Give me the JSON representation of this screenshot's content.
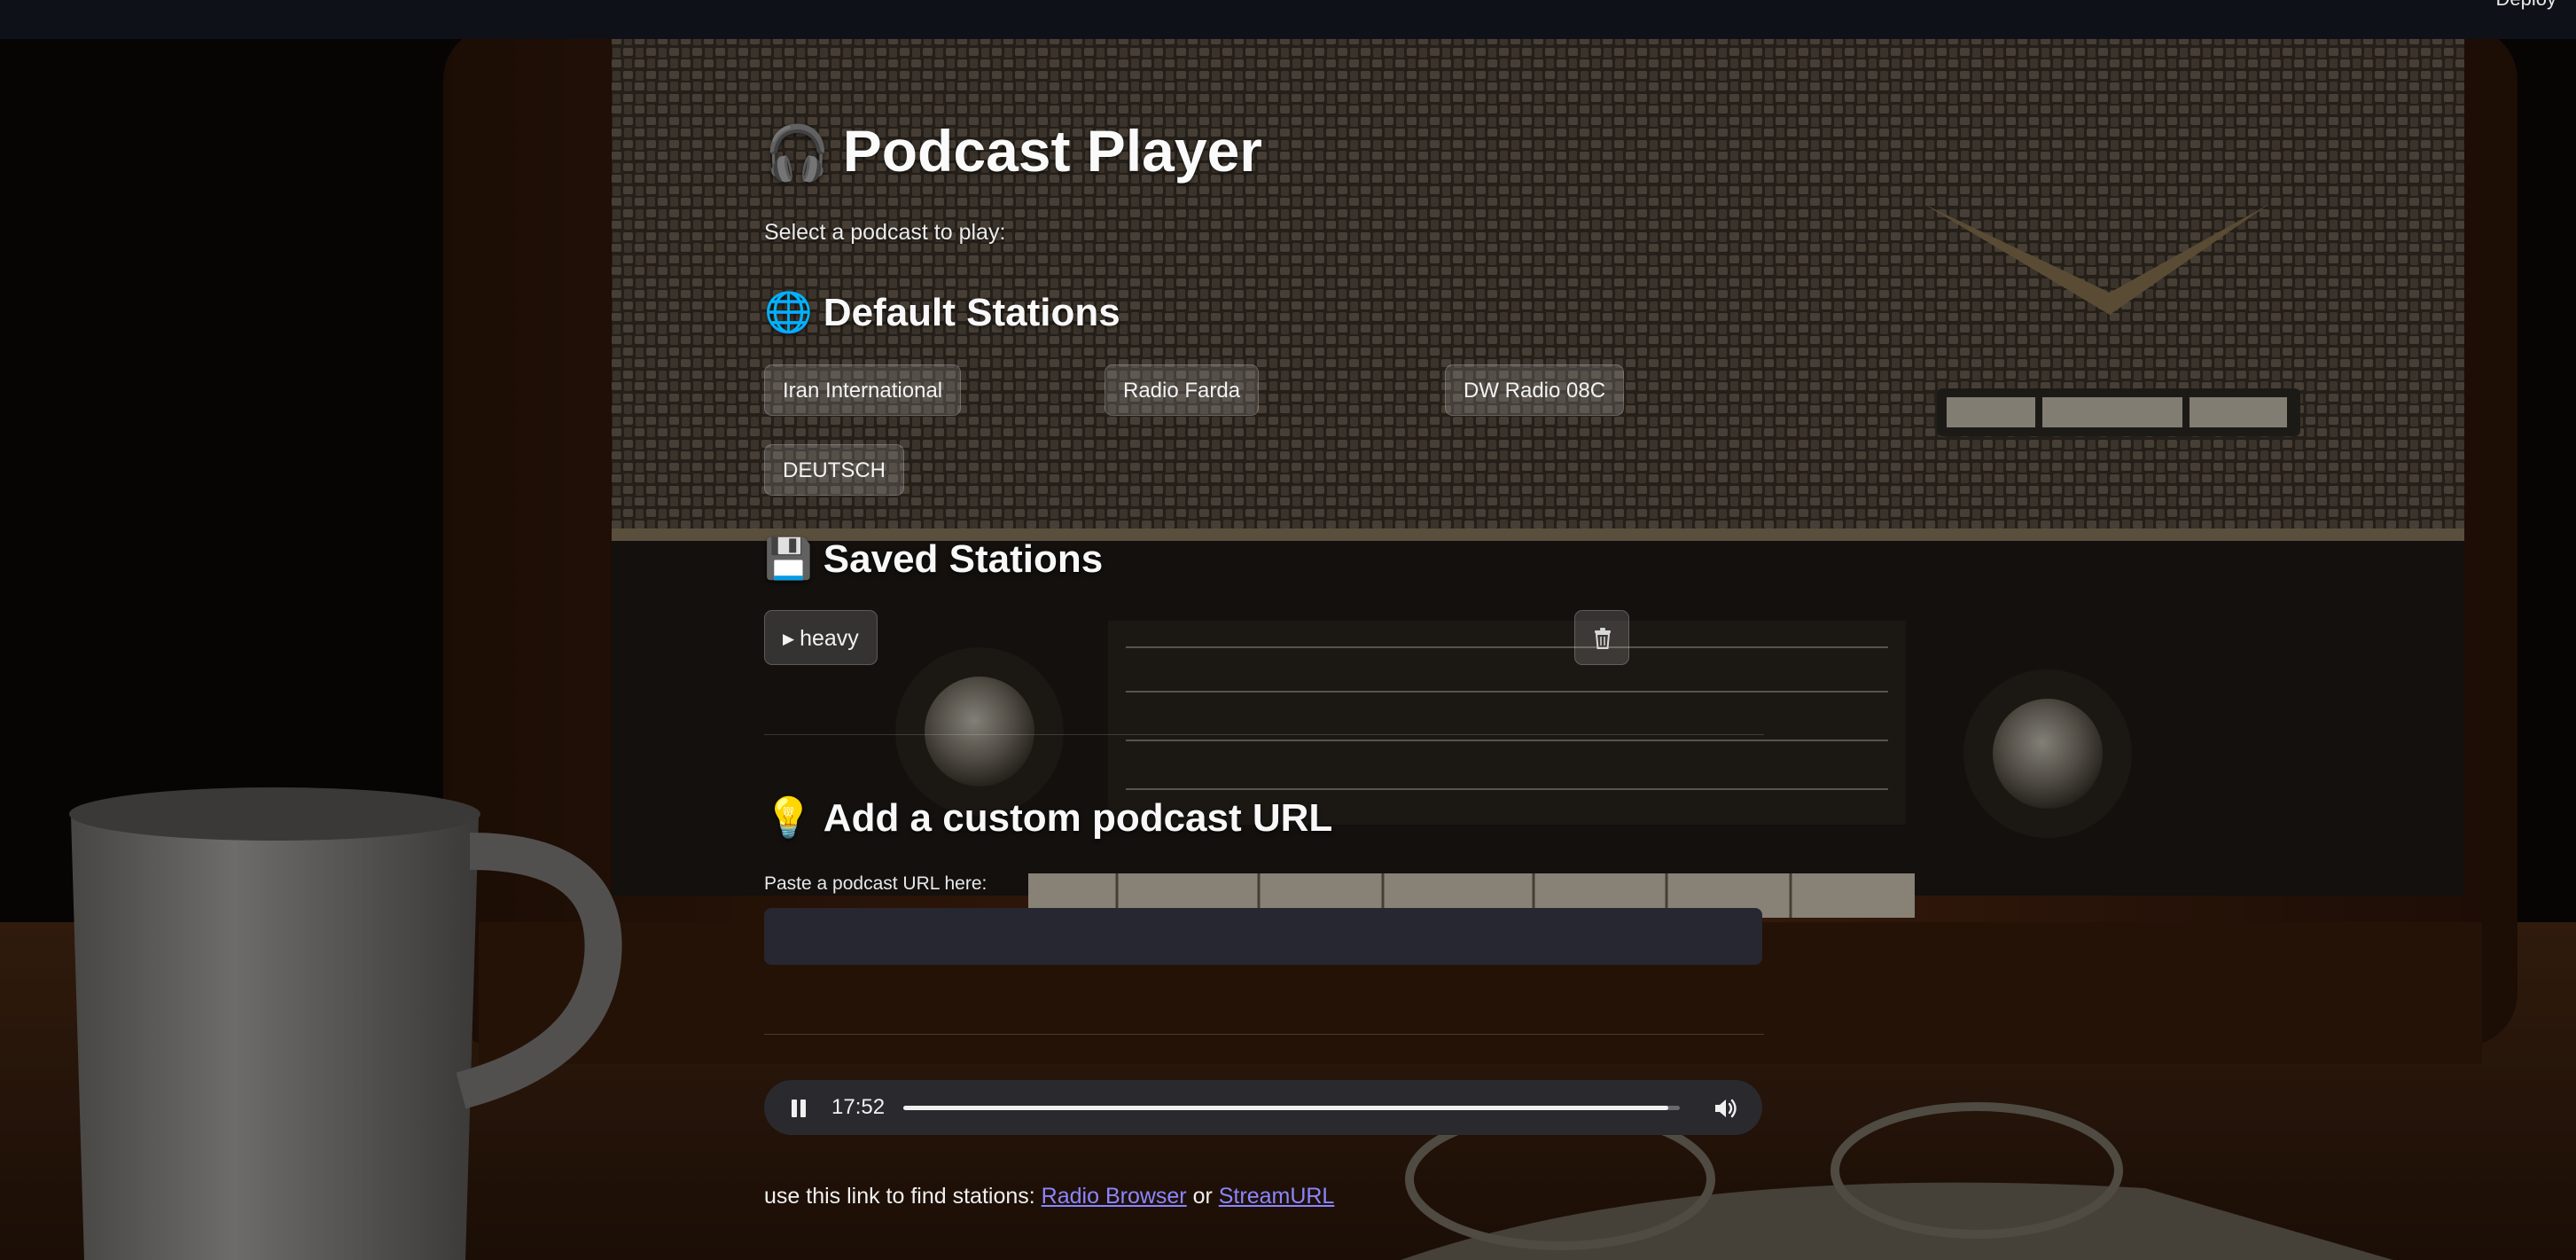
{
  "header": {
    "deploy_label": "Deploy"
  },
  "page": {
    "title_icon": "headphones-icon",
    "title": "Podcast Player",
    "subtitle": "Select a podcast to play:"
  },
  "default_stations": {
    "icon": "globe-icon",
    "heading": "Default Stations",
    "items": [
      {
        "label": "Iran International"
      },
      {
        "label": "Radio Farda"
      },
      {
        "label": "DW Radio 08C"
      },
      {
        "label": "DEUTSCH"
      }
    ]
  },
  "saved_stations": {
    "icon": "floppy-disk-icon",
    "heading": "Saved Stations",
    "items": [
      {
        "play_icon": "play-icon",
        "label": "heavy",
        "delete_icon": "trash-icon"
      }
    ]
  },
  "custom": {
    "icon": "lightbulb-icon",
    "heading": "Add a custom podcast URL",
    "field_label": "Paste a podcast URL here:",
    "field_value": ""
  },
  "player": {
    "state": "playing",
    "time": "17:52",
    "progress": 0.985,
    "pause_icon": "pause-icon",
    "volume_icon": "volume-icon"
  },
  "footer": {
    "text": "use this link to find stations: ",
    "link1": "Radio Browser",
    "or": " or ",
    "link2": "StreamURL"
  },
  "colors": {
    "header_bg": "#0e1117",
    "input_bg": "#262730",
    "player_bg": "#2a2a2e",
    "link": "#8a86ff"
  }
}
